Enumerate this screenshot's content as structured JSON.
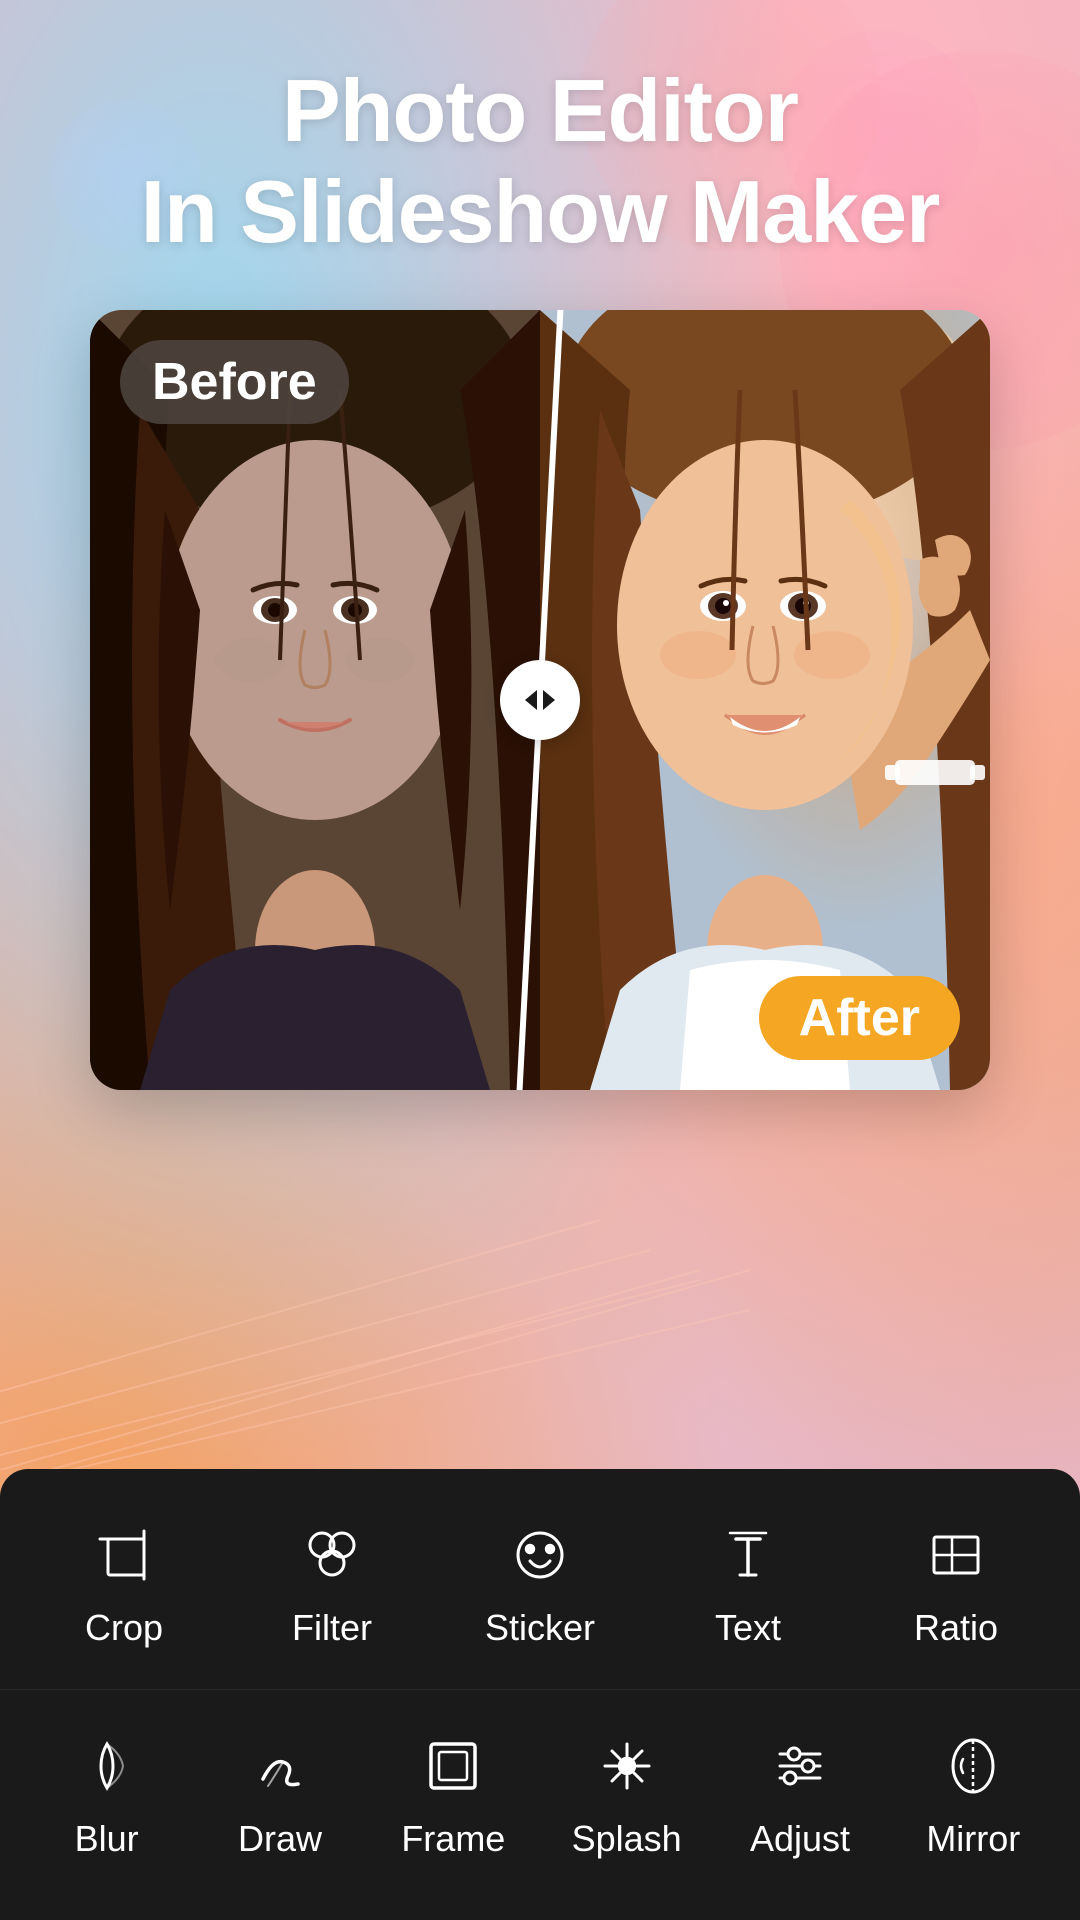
{
  "title": {
    "line1": "Photo Editor",
    "line2": "In Slideshow Maker"
  },
  "comparison": {
    "before_label": "Before",
    "after_label": "After"
  },
  "toolbar_row1": [
    {
      "id": "crop",
      "label": "Crop",
      "icon": "crop-icon"
    },
    {
      "id": "filter",
      "label": "Filter",
      "icon": "filter-icon"
    },
    {
      "id": "sticker",
      "label": "Sticker",
      "icon": "sticker-icon"
    },
    {
      "id": "text",
      "label": "Text",
      "icon": "text-icon"
    },
    {
      "id": "ratio",
      "label": "Ratio",
      "icon": "ratio-icon"
    }
  ],
  "toolbar_row2": [
    {
      "id": "blur",
      "label": "Blur",
      "icon": "blur-icon"
    },
    {
      "id": "draw",
      "label": "Draw",
      "icon": "draw-icon"
    },
    {
      "id": "frame",
      "label": "Frame",
      "icon": "frame-icon"
    },
    {
      "id": "splash",
      "label": "Splash",
      "icon": "splash-icon"
    },
    {
      "id": "adjust",
      "label": "Adjust",
      "icon": "adjust-icon"
    },
    {
      "id": "mirror",
      "label": "Mirror",
      "icon": "mirror-icon"
    }
  ],
  "colors": {
    "bg_primary": "#e8b4c0",
    "toolbar_bg": "#1a1a1a",
    "before_bg": "#6a5040",
    "after_accent": "#f5a623",
    "icon_color": "#ffffff",
    "label_before_bg": "rgba(80,70,65,0.85)"
  }
}
